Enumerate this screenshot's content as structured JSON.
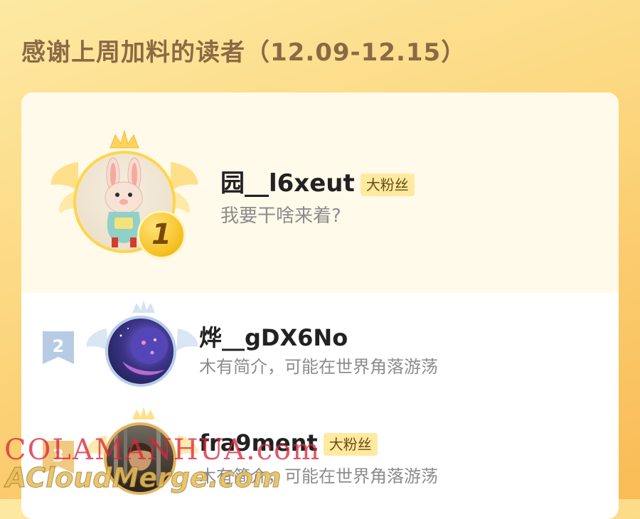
{
  "header": {
    "title": "感谢上周加料的读者（12.09-12.15）"
  },
  "leaderboard": [
    {
      "rank": "1",
      "name": "园__l6xeut",
      "badge": "大粉丝",
      "bio": "我要干啥来着?"
    },
    {
      "rank": "2",
      "name": "烨__gDX6No",
      "bio": "木有简介，可能在世界角落游荡"
    },
    {
      "rank": "3",
      "name": "fra9ment",
      "badge": "大粉丝",
      "bio": "木有简介，可能在世界角落游荡"
    }
  ],
  "watermark": {
    "line1": "COLAMANHUA.com",
    "line2": "ACloudMerge.com"
  },
  "colors": {
    "gold": "#ffd54a",
    "silver": "#b9cde8",
    "bronze": "#e6b35a",
    "badge_bg": "#ffeaa0"
  },
  "icons": [
    "crown-icon",
    "wings-icon",
    "rank-medal-icon",
    "rank-flag-icon"
  ]
}
